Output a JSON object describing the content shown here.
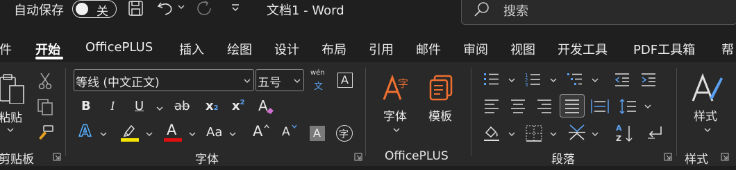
{
  "titlebar": {
    "autosave_label": "自动保存",
    "autosave_state": "关",
    "document_title": "文档1  -  Word",
    "search_placeholder": "搜索"
  },
  "tabs": [
    "件",
    "开始",
    "OfficePLUS",
    "插入",
    "绘图",
    "设计",
    "布局",
    "引用",
    "邮件",
    "审阅",
    "视图",
    "开发工具",
    "PDF工具箱",
    "帮"
  ],
  "active_tab": "开始",
  "ribbon": {
    "clipboard": {
      "paste_label": "粘贴",
      "group_label": "剪贴板"
    },
    "font": {
      "font_name": "等线 (中文正文)",
      "font_size": "五号",
      "wen_top": "wén",
      "wen_bottom": "文",
      "border_char": "A",
      "bold": "B",
      "italic": "I",
      "underline": "U",
      "strike": "ab",
      "sub": "x",
      "sub_small": "2",
      "sup": "x",
      "sup_small": "2",
      "clear_fmt": "A",
      "text_effect": "A",
      "font_color": "A",
      "change_case": "Aa",
      "grow": "A",
      "shrink": "A",
      "char_shading": "A",
      "enclose_char": "字",
      "group_label": "字体",
      "highlight_color": "#f5e400",
      "font_color_bar": "#e01010"
    },
    "officeplus": {
      "font_btn": "字体",
      "template_btn": "模板",
      "group_label": "OfficePLUS"
    },
    "paragraph": {
      "group_label": "段落"
    },
    "styles": {
      "styles_btn": "样式",
      "group_label": "样式"
    }
  }
}
